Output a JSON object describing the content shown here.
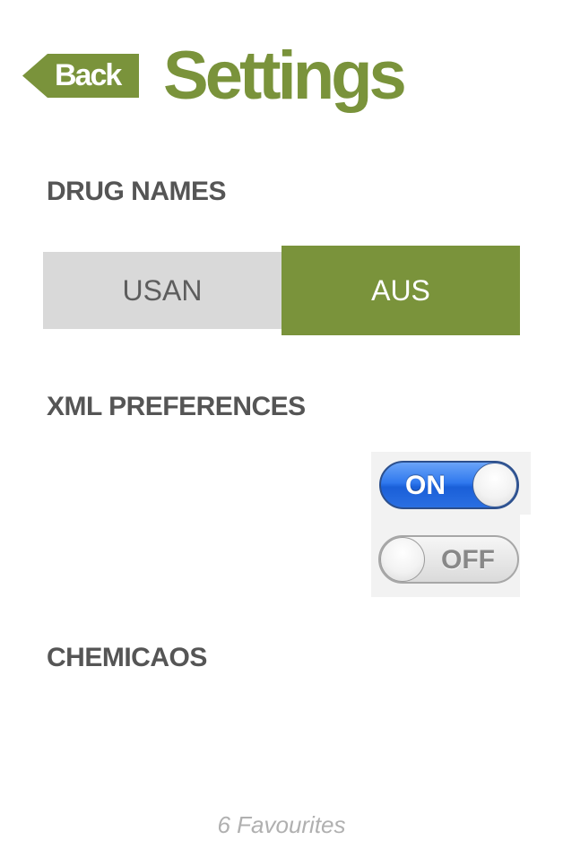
{
  "header": {
    "back_label": "Back",
    "title": "Settings"
  },
  "sections": {
    "drug_names": {
      "heading": "DRUG NAMES",
      "options": [
        "USAN",
        "AUS"
      ],
      "selected": "AUS"
    },
    "xml_preferences": {
      "heading": "XML PREFERENCES",
      "toggle_on_label": "ON",
      "toggle_off_label": "OFF"
    },
    "chemicaos": {
      "heading": "CHEMICAOS"
    }
  },
  "footer": {
    "text": "6 Favourites"
  },
  "colors": {
    "brand_green": "#7a933b",
    "heading_gray": "#555555",
    "segment_unselected": "#d9d9d9",
    "toggle_on_blue": "#2f78ee",
    "footer_gray": "#b0b0b0"
  },
  "icons": {
    "back": "arrow-left-shape"
  }
}
